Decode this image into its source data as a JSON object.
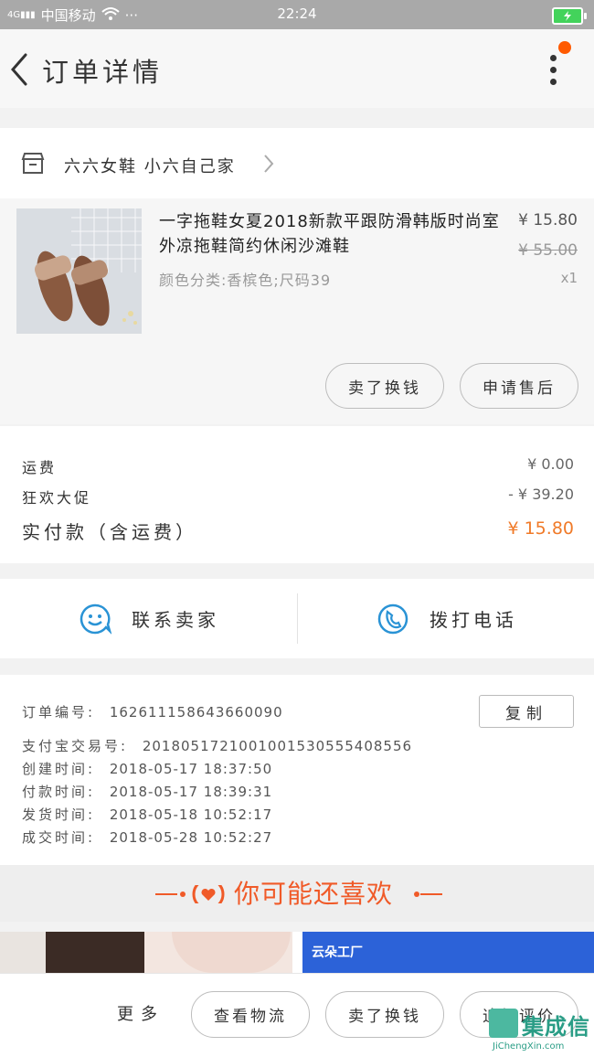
{
  "status_bar": {
    "network": "4G",
    "carrier": "中国移动",
    "more": "···",
    "time": "22:24"
  },
  "header": {
    "title": "订单详情"
  },
  "shop": {
    "name": "六六女鞋 小六自己家"
  },
  "product": {
    "title": "一字拖鞋女夏2018新款平跟防滑韩版时尚室外凉拖鞋简约休闲沙滩鞋",
    "spec": "颜色分类:香槟色;尺码39",
    "price": "¥ 15.80",
    "original_price": "¥ 55.00",
    "quantity": "x1",
    "actions": [
      "卖了换钱",
      "申请售后"
    ]
  },
  "costs": {
    "shipping_label": "运费",
    "shipping_value": "¥ 0.00",
    "discount_label": "狂欢大促",
    "discount_value": "- ¥ 39.20",
    "paid_label": "实付款（含运费）",
    "paid_value": "¥ 15.80"
  },
  "contact": {
    "seller": "联系卖家",
    "phone": "拨打电话"
  },
  "order_info": {
    "order_no_label": "订单编号:",
    "order_no": "162611158643660090",
    "copy": "复制",
    "alipay_label": "支付宝交易号:",
    "alipay_no": "2018051721001001530555408556",
    "created_label": "创建时间:",
    "created": "2018-05-17 18:37:50",
    "paid_label": "付款时间:",
    "paid": "2018-05-17 18:39:31",
    "shipped_label": "发货时间:",
    "shipped": "2018-05-18 10:52:17",
    "done_label": "成交时间:",
    "done": "2018-05-28 10:52:27"
  },
  "recommend": {
    "title": "你可能还喜欢"
  },
  "strip": {
    "brand_text": "云朵工厂"
  },
  "bottom_bar": {
    "more": "更多",
    "buttons": [
      "查看物流",
      "卖了换钱",
      "追加评价"
    ]
  },
  "watermark": {
    "text": "集成信",
    "url": "JiChengXin.com"
  },
  "colors": {
    "accent": "#f05a28",
    "price_orange": "#f07a28",
    "icon_blue": "#2a93d5",
    "notif": "#ff5a00"
  }
}
